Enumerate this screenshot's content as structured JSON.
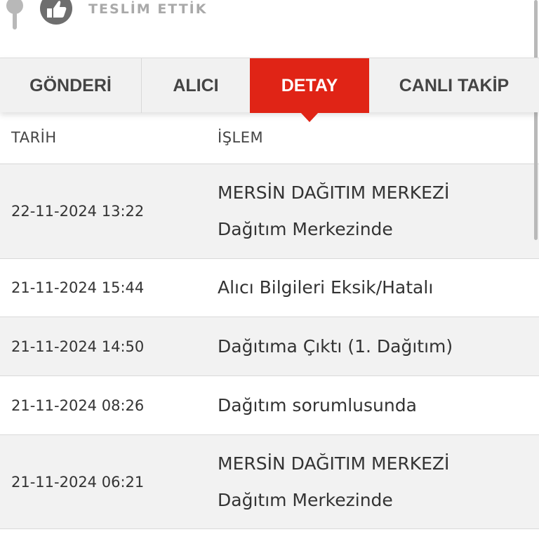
{
  "status": {
    "label": "TESLİM ETTİK",
    "icons": [
      "pin-icon",
      "thumbs-up-icon"
    ]
  },
  "tabs": [
    {
      "label": "GÖNDERİ",
      "active": false
    },
    {
      "label": "ALICI",
      "active": false
    },
    {
      "label": "DETAY",
      "active": true
    },
    {
      "label": "CANLI TAKİP",
      "active": false
    }
  ],
  "colors": {
    "accent": "#e02416",
    "tab_bg": "#f1f1f1",
    "row_alt": "#f2f2f2"
  },
  "table": {
    "headers": {
      "date": "TARİH",
      "operation": "İŞLEM"
    },
    "rows": [
      {
        "date": "22-11-2024 13:22",
        "lines": [
          "MERSİN DAĞITIM MERKEZİ",
          "Dağıtım Merkezinde"
        ]
      },
      {
        "date": "21-11-2024 15:44",
        "lines": [
          "Alıcı Bilgileri Eksik/Hatalı"
        ]
      },
      {
        "date": "21-11-2024 14:50",
        "lines": [
          "Dağıtıma Çıktı (1. Dağıtım)"
        ]
      },
      {
        "date": "21-11-2024 08:26",
        "lines": [
          "Dağıtım sorumlusunda"
        ]
      },
      {
        "date": "21-11-2024 06:21",
        "lines": [
          "MERSİN DAĞITIM MERKEZİ",
          "Dağıtım Merkezinde"
        ]
      }
    ]
  }
}
